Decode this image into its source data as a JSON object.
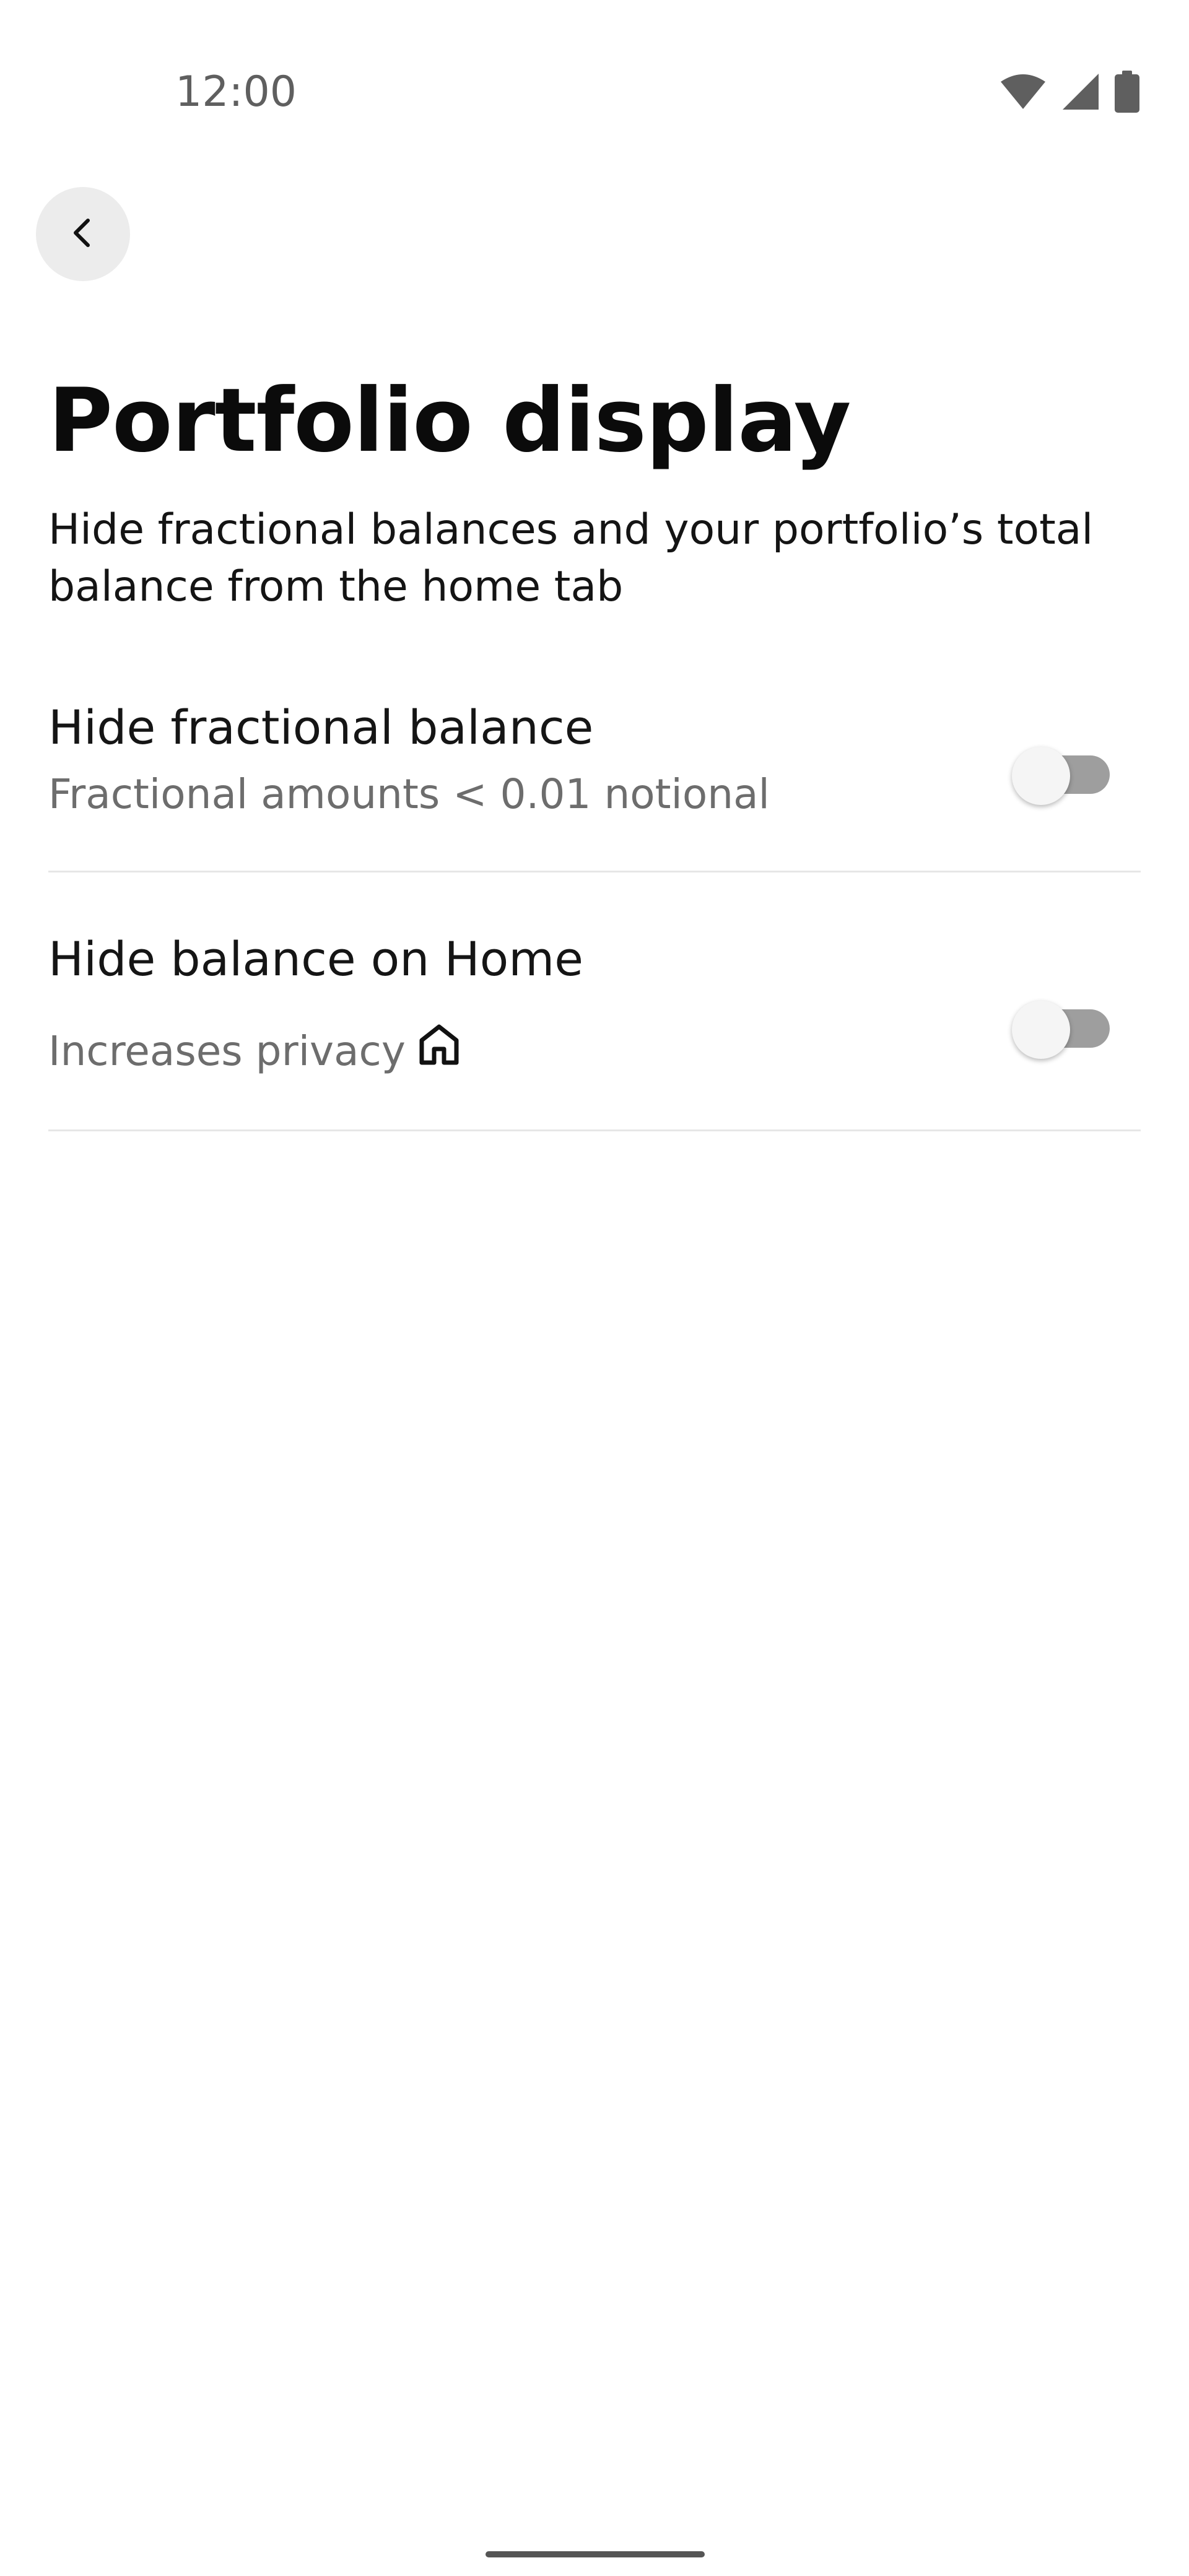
{
  "status_bar": {
    "time": "12:00",
    "icons": [
      "wifi-icon",
      "cellular-signal-icon",
      "battery-icon"
    ]
  },
  "navigation": {
    "back_icon": "chevron-left-icon"
  },
  "page": {
    "title": "Portfolio display",
    "description": "Hide fractional balances and your portfolio’s total balance from the home tab"
  },
  "settings": [
    {
      "title": "Hide fractional balance",
      "subtitle": "Fractional amounts < 0.01 notional",
      "enabled": false
    },
    {
      "title": "Hide balance on Home",
      "subtitle": "Increases privacy",
      "subtitle_icon": "home-icon",
      "enabled": false
    }
  ],
  "colors": {
    "toggle_track_off": "#9e9e9e",
    "toggle_thumb": "#f5f5f5",
    "divider": "#e6e6e6",
    "back_button_bg": "#ececec"
  }
}
